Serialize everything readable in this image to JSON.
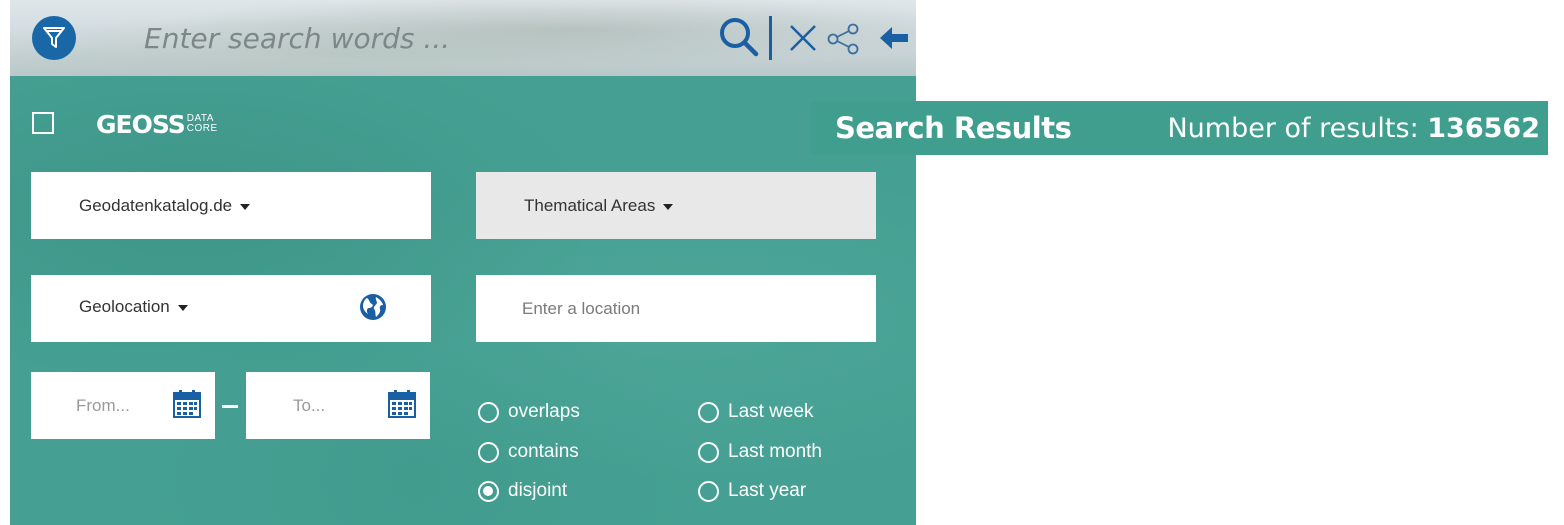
{
  "search": {
    "placeholder": "Enter search words ..."
  },
  "toolbar": {
    "filter_icon": "filter-icon",
    "search_icon": "search-icon",
    "clear_icon": "close-icon",
    "share_icon": "share-icon",
    "back_icon": "arrow-left-icon"
  },
  "logo": {
    "main": "GEOSS",
    "sub_top": "DATA",
    "sub_bottom": "CORE"
  },
  "filters": {
    "catalog_label": "Geodatenkatalog.de",
    "thematic_label": "Thematical Areas",
    "geolocation_label": "Geolocation",
    "location_placeholder": "Enter a location",
    "from_placeholder": "From...",
    "to_placeholder": "To..."
  },
  "spatial_relations": [
    {
      "label": "overlaps",
      "selected": false
    },
    {
      "label": "contains",
      "selected": false
    },
    {
      "label": "disjoint",
      "selected": true
    }
  ],
  "time_ranges": [
    {
      "label": "Last week",
      "selected": false
    },
    {
      "label": "Last month",
      "selected": false
    },
    {
      "label": "Last year",
      "selected": false
    }
  ],
  "results": {
    "title": "Search Results",
    "count_label": "Number of results:",
    "count": "136562"
  },
  "colors": {
    "panel": "#45a093",
    "results_bar": "#3f9e8e",
    "accent_blue": "#1a67a8",
    "thematic_bg": "#e8e8e8"
  }
}
